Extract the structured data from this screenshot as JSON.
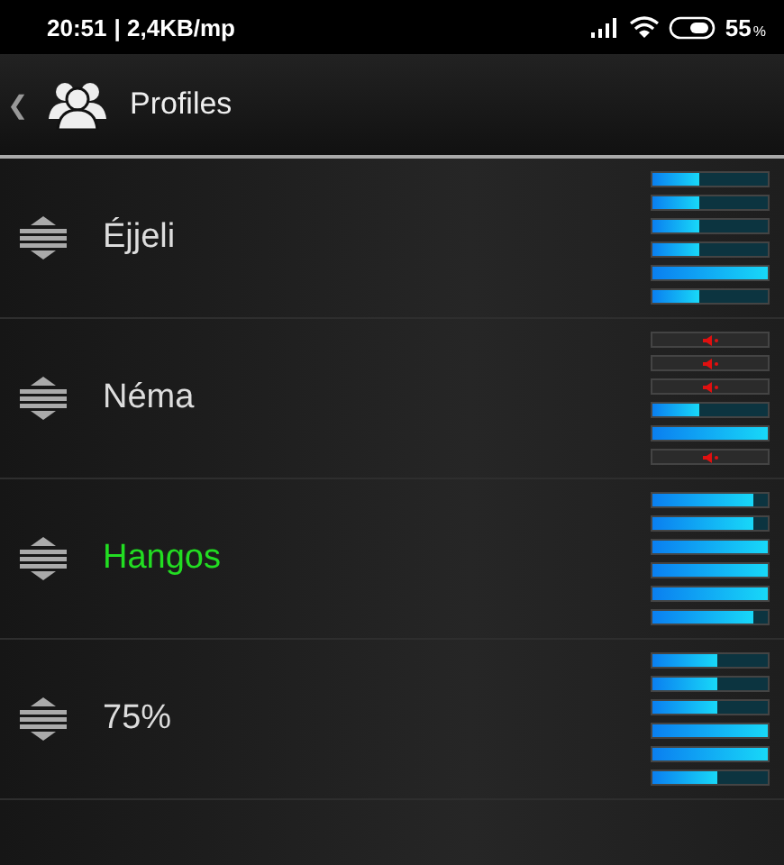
{
  "status_bar": {
    "time": "20:51",
    "speed": "| 2,4KB/mp",
    "battery": "55",
    "battery_unit": "%"
  },
  "header": {
    "back": "❮",
    "title": "Profiles"
  },
  "profiles": [
    {
      "name": "Éjjeli",
      "selected": false,
      "channels": [
        {
          "muted": false,
          "level": 0.4
        },
        {
          "muted": false,
          "level": 0.4
        },
        {
          "muted": false,
          "level": 0.4
        },
        {
          "muted": false,
          "level": 0.4
        },
        {
          "muted": false,
          "level": 1
        },
        {
          "muted": false,
          "level": 0.4
        }
      ]
    },
    {
      "name": "Néma",
      "selected": false,
      "channels": [
        {
          "muted": true
        },
        {
          "muted": true
        },
        {
          "muted": true
        },
        {
          "muted": false,
          "level": 0.4
        },
        {
          "muted": false,
          "level": 1
        },
        {
          "muted": true
        }
      ]
    },
    {
      "name": "Hangos",
      "selected": true,
      "channels": [
        {
          "muted": false,
          "level": 0.88
        },
        {
          "muted": false,
          "level": 0.88
        },
        {
          "muted": false,
          "level": 1
        },
        {
          "muted": false,
          "level": 1
        },
        {
          "muted": false,
          "level": 1
        },
        {
          "muted": false,
          "level": 0.88
        }
      ]
    },
    {
      "name": "75%",
      "selected": false,
      "channels": [
        {
          "muted": false,
          "level": 0.57
        },
        {
          "muted": false,
          "level": 0.57
        },
        {
          "muted": false,
          "level": 0.57
        },
        {
          "muted": false,
          "level": 1
        },
        {
          "muted": false,
          "level": 1
        },
        {
          "muted": false,
          "level": 0.57
        }
      ]
    }
  ]
}
